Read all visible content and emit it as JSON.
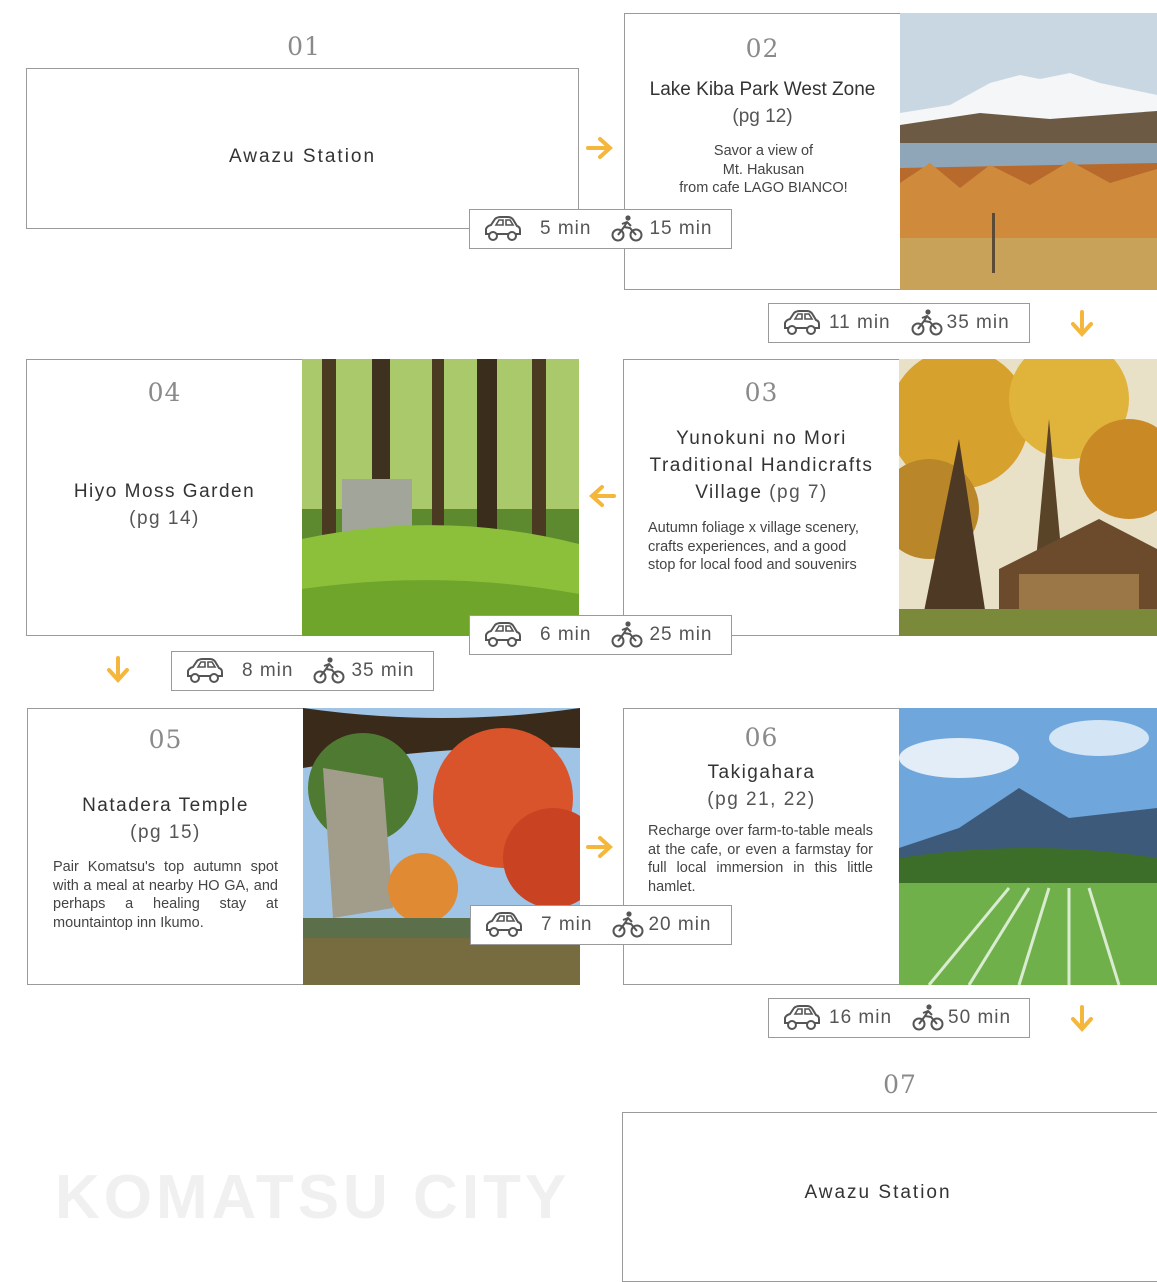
{
  "watermark": "KOMATSU CITY",
  "accent_color": "#f5b63c",
  "stops": [
    {
      "num": "01",
      "title": "Awazu Station"
    },
    {
      "num": "02",
      "title": "Lake Kiba Park West Zone",
      "pg": "(pg 12)",
      "desc": "Savor a view of\nMt. Hakusan\nfrom cafe LAGO BIANCO!"
    },
    {
      "num": "03",
      "title_lines": [
        "Yunokuni no Mori",
        "Traditional Handicrafts",
        "Village"
      ],
      "pg": "(pg 7)",
      "desc": "Autumn foliage x village scenery, crafts experiences, and a good stop for local food and souvenirs"
    },
    {
      "num": "04",
      "title": "Hiyo Moss Garden",
      "pg": "(pg 14)"
    },
    {
      "num": "05",
      "title": "Natadera Temple",
      "pg": "(pg 15)",
      "desc": "Pair Komatsu's top autumn spot with a meal at nearby HO GA, and perhaps a healing stay at mountaintop inn Ikumo."
    },
    {
      "num": "06",
      "title": "Takigahara",
      "pg": "(pg 21, 22)",
      "desc": "Recharge over farm-to-table meals at the cafe, or even a farmstay for full local immersion in this little hamlet."
    },
    {
      "num": "07",
      "title": "Awazu Station"
    }
  ],
  "legs": [
    {
      "car": "5 min",
      "bike": "15 min"
    },
    {
      "car": "11 min",
      "bike": "35 min"
    },
    {
      "car": "6 min",
      "bike": "25 min"
    },
    {
      "car": "8 min",
      "bike": "35 min"
    },
    {
      "car": "7 min",
      "bike": "20 min"
    },
    {
      "car": "16 min",
      "bike": "50 min"
    }
  ],
  "icons": {
    "car": "car-icon",
    "bike": "bicycle-icon",
    "arrow": "arrow-icon"
  }
}
